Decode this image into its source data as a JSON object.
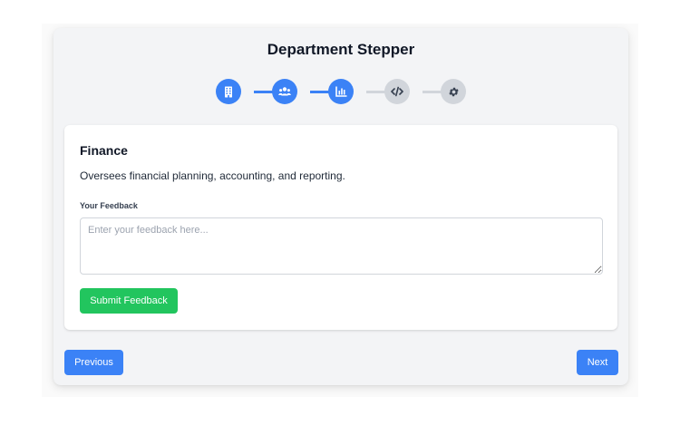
{
  "app": {
    "title": "Department Stepper"
  },
  "stepper": {
    "current_step": 3,
    "steps": [
      {
        "icon": "building-icon",
        "status": "completed"
      },
      {
        "icon": "users-icon",
        "status": "completed"
      },
      {
        "icon": "chart-icon",
        "status": "current"
      },
      {
        "icon": "code-icon",
        "status": "upcoming"
      },
      {
        "icon": "gear-icon",
        "status": "upcoming"
      }
    ]
  },
  "department": {
    "name": "Finance",
    "description": "Oversees financial planning, accounting, and reporting."
  },
  "feedback": {
    "label": "Your Feedback",
    "placeholder": "Enter your feedback here...",
    "value": "",
    "submit_label": "Submit Feedback"
  },
  "navigation": {
    "previous_label": "Previous",
    "next_label": "Next"
  },
  "colors": {
    "accent": "#3b82f6",
    "inactive": "#d1d5db",
    "success": "#22c55e",
    "panel": "#f3f4f6"
  }
}
